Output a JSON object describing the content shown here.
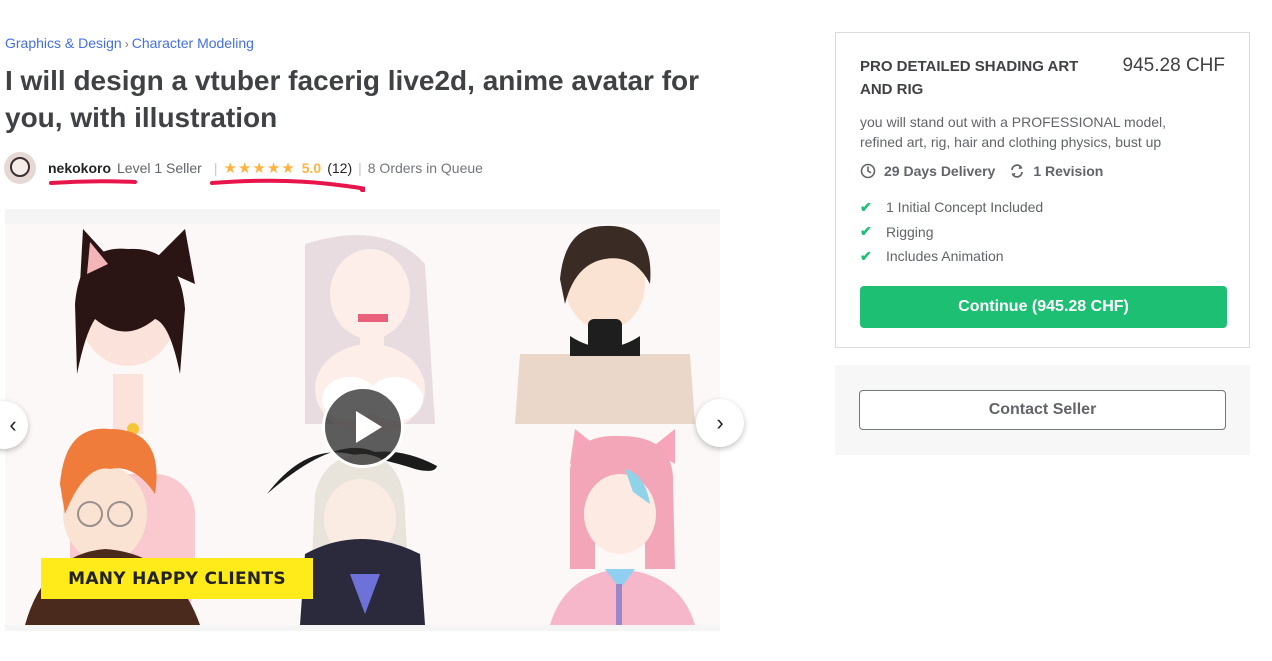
{
  "breadcrumb": {
    "items": [
      "Graphics & Design",
      "Character Modeling"
    ],
    "separator": "›"
  },
  "gig": {
    "title": "I will design a vtuber facerig live2d, anime avatar for you, with illustration"
  },
  "seller": {
    "username": "nekokoro",
    "level": "Level 1 Seller",
    "stars": "★★★★★",
    "rating": "5.0",
    "review_count": "(12)",
    "orders_queue": "8 Orders in Queue"
  },
  "gallery": {
    "banner_text": "MANY HAPPY CLIENTS",
    "prev_icon": "‹",
    "next_icon": "›"
  },
  "package": {
    "name": "PRO DETAILED SHADING ART AND RIG",
    "price": "945.28 CHF",
    "description": "you will stand out with a PROFESSIONAL model, refined art, rig, hair and clothing physics, bust up",
    "delivery": "29 Days Delivery",
    "revisions": "1 Revision",
    "features": [
      "1 Initial Concept Included",
      "Rigging",
      "Includes Animation"
    ],
    "continue_label": "Continue (945.28 CHF)"
  },
  "contact": {
    "label": "Contact Seller"
  },
  "colors": {
    "accent_green": "#1dbf73",
    "star_yellow": "#ffb33e",
    "link_blue": "#446ee7",
    "annotation_red": "#e8154a",
    "banner_yellow": "#ffeb19"
  }
}
